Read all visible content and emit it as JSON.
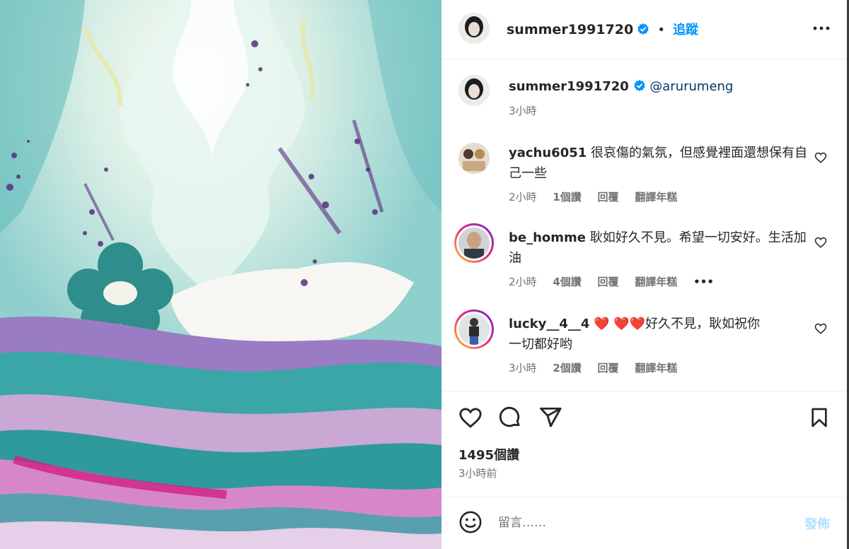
{
  "post": {
    "author": "summer1991720",
    "follow_label": "追蹤",
    "separator": "•",
    "caption_mention": "@arurumeng",
    "caption_time": "3小時"
  },
  "comments": [
    {
      "username": "yachu6051",
      "text": "很哀傷的氣氛，但感覺裡面還想保有自己一些",
      "time": "2小時",
      "likes": "1個讚",
      "reply": "回覆",
      "translate": "翻譯年糕"
    },
    {
      "username": "be_homme",
      "text": "耿如好久不見。希望一切安好。生活加油",
      "time": "2小時",
      "likes": "4個讚",
      "reply": "回覆",
      "translate": "翻譯年糕",
      "more": "•••"
    },
    {
      "username": "lucky__4__4",
      "text": "❤️ ❤️❤️好久不見，耿如祝你一切都好哟",
      "time": "3小時",
      "likes": "2個讚",
      "reply": "回覆",
      "translate": "翻譯年糕"
    }
  ],
  "stats": {
    "likes": "1495個讚",
    "time": "3小時前"
  },
  "comment_box": {
    "placeholder": "留言……",
    "post_label": "發佈"
  },
  "icons": {
    "like": "heart-icon",
    "comment": "comment-icon",
    "share": "share-icon",
    "save": "bookmark-icon",
    "emoji": "emoji-icon",
    "more": "more-icon",
    "verified": "verified-badge-icon"
  },
  "colors": {
    "link": "#0095f6",
    "text": "#262626",
    "muted": "#737373",
    "verified": "#0095f6",
    "post_disabled": "#b2dffc"
  }
}
